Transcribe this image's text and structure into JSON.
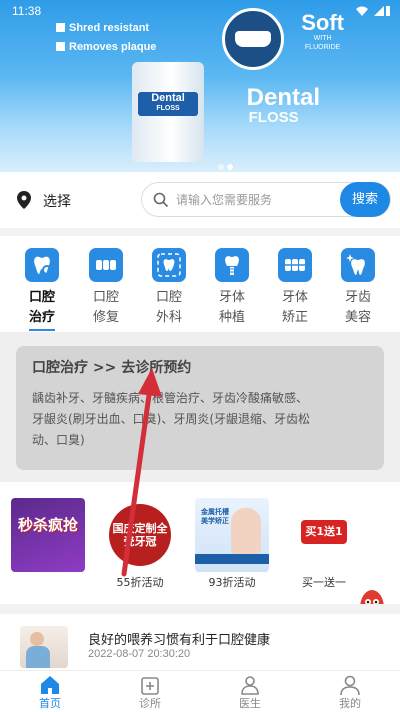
{
  "status_bar": {
    "time": "11:38"
  },
  "banner": {
    "bullets": [
      "Shred resistant",
      "Removes plaque"
    ],
    "box_brand": "Dental",
    "box_sub": "FLOSS",
    "soft_title": "Soft",
    "soft_sub1": "WITH",
    "soft_sub2": "FLUORIDE",
    "big_brand": "Dental",
    "big_sub": "FLOSS",
    "active_page": 2,
    "page_count": 2
  },
  "search": {
    "location_label": "选择",
    "placeholder": "请输入您需要服务",
    "button_label": "搜索"
  },
  "categories": [
    {
      "id": "oral-treatment",
      "line1": "口腔",
      "line2": "治疗",
      "icon": "tooth-search-icon",
      "active": true
    },
    {
      "id": "oral-repair",
      "line1": "口腔",
      "line2": "修复",
      "icon": "teeth-row-icon",
      "active": false
    },
    {
      "id": "oral-surgery",
      "line1": "口腔",
      "line2": "外科",
      "icon": "tooth-frame-icon",
      "active": false
    },
    {
      "id": "implant",
      "line1": "牙体",
      "line2": "种植",
      "icon": "tooth-implant-icon",
      "active": false
    },
    {
      "id": "orthodontic",
      "line1": "牙体",
      "line2": "矫正",
      "icon": "braces-icon",
      "active": false
    },
    {
      "id": "cosmetic",
      "line1": "牙齿",
      "line2": "美容",
      "icon": "sparkle-tooth-icon",
      "active": false
    }
  ],
  "panel": {
    "title": "口腔治疗 >> 去诊所预约",
    "desc_lines": [
      "龋齿补牙、牙髓疾病、根管治疗、牙齿冷酸痛敏感、",
      "牙龈炎(刷牙出血、口臭)、牙周炎(牙龈退缩、牙齿松",
      "动、口臭)"
    ]
  },
  "promos": [
    {
      "label": "",
      "img_text": "秒杀疯抢"
    },
    {
      "label": "55折活动",
      "img_text": "国庆定制全瓷牙冠"
    },
    {
      "label": "93折活动",
      "img_text": "金属托槽 美学矫正"
    },
    {
      "label": "买一送一",
      "img_text": "买1送1"
    }
  ],
  "article": {
    "title": "良好的喂养习惯有利于口腔健康",
    "time": "2022-08-07 20:30:20"
  },
  "tabbar": [
    {
      "label": "首页",
      "icon": "home-icon",
      "active": true
    },
    {
      "label": "诊所",
      "icon": "clinic-icon",
      "active": false
    },
    {
      "label": "医生",
      "icon": "doctor-icon",
      "active": false
    },
    {
      "label": "我的",
      "icon": "profile-icon",
      "active": false
    }
  ],
  "colors": {
    "accent": "#1e88e5",
    "arrow": "#d32f3a",
    "panel_bg": "#d4d4d4"
  }
}
